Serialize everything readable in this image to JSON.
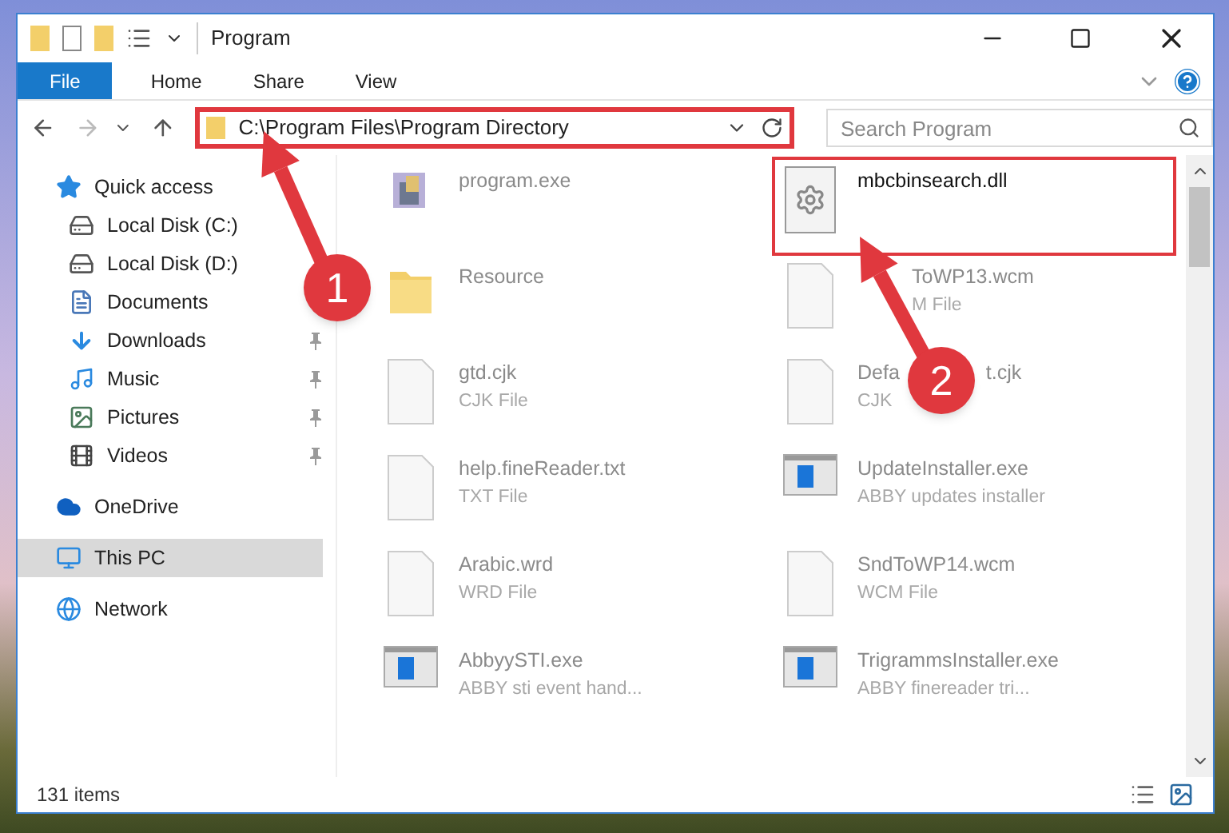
{
  "window": {
    "title": "Program"
  },
  "ribbon_tabs": [
    {
      "label": "File",
      "selected": true
    },
    {
      "label": "Home",
      "selected": false
    },
    {
      "label": "Share",
      "selected": false
    },
    {
      "label": "View",
      "selected": false
    }
  ],
  "address": {
    "value": "C:\\Program Files\\Program Directory",
    "highlighted": true
  },
  "search": {
    "placeholder": "Search Program"
  },
  "sidebar": {
    "items": [
      {
        "label": "Quick access",
        "kind": "star",
        "selected": false,
        "children": [
          {
            "label": "Local Disk (C:)",
            "kind": "disk",
            "pinned": false,
            "selected": false
          },
          {
            "label": "Local Disk (D:)",
            "kind": "disk",
            "pinned": false,
            "selected": false
          },
          {
            "label": "Documents",
            "kind": "doc",
            "pinned": false,
            "selected": false
          },
          {
            "label": "Downloads",
            "kind": "download",
            "pinned": true,
            "selected": false
          },
          {
            "label": "Music",
            "kind": "music",
            "pinned": true,
            "selected": false
          },
          {
            "label": "Pictures",
            "kind": "pictures",
            "pinned": true,
            "selected": false
          },
          {
            "label": "Videos",
            "kind": "videos",
            "pinned": true,
            "selected": false
          }
        ]
      },
      {
        "label": "OneDrive",
        "kind": "cloud",
        "selected": false
      },
      {
        "label": "This PC",
        "kind": "pc",
        "selected": true
      },
      {
        "label": "Network",
        "kind": "network",
        "selected": false
      }
    ]
  },
  "files": [
    {
      "name": "program.exe",
      "kind": "app",
      "highlighted": false
    },
    {
      "name": "mbcbinsearch.dll",
      "kind": "dll",
      "highlighted": true
    },
    {
      "name": "Resource",
      "kind": "folder",
      "highlighted": false
    },
    {
      "name": "ToWP13.wcm",
      "type": "M File",
      "kind": "file",
      "highlighted": false,
      "partly_covered": true
    },
    {
      "name": "gtd.cjk",
      "type": "CJK File",
      "kind": "file",
      "highlighted": false
    },
    {
      "name": "Defa",
      "name_tail": "t.cjk",
      "type": "CJK",
      "kind": "file",
      "highlighted": false
    },
    {
      "name": "help.fineReader.txt",
      "type": "TXT File",
      "kind": "file",
      "highlighted": false
    },
    {
      "name": "UpdateInstaller.exe",
      "type": "ABBY updates installer",
      "kind": "installer",
      "highlighted": false
    },
    {
      "name": "Arabic.wrd",
      "type": "WRD File",
      "kind": "file",
      "highlighted": false
    },
    {
      "name": "SndToWP14.wcm",
      "type": "WCM File",
      "kind": "file",
      "highlighted": false
    },
    {
      "name": "AbbyySTI.exe",
      "type": "ABBY sti event hand...",
      "kind": "installer",
      "highlighted": false
    },
    {
      "name": "TrigrammsInstaller.exe",
      "type": "ABBY finereader tri...",
      "kind": "installer",
      "highlighted": false
    }
  ],
  "status_bar": {
    "count": "131 items"
  },
  "callouts": [
    {
      "number": "1"
    },
    {
      "number": "2"
    }
  ]
}
